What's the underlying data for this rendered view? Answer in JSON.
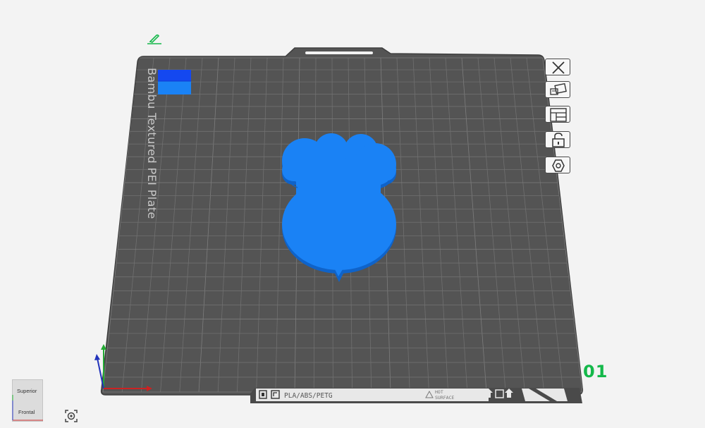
{
  "plate": {
    "name_text": "Bambu Textured PEI Plate",
    "filaments_text": "PLA/ABS/PETG",
    "surface_text_line1": "HOT",
    "surface_text_line2": "SURFACE",
    "number": "01"
  },
  "view_cube": {
    "top_label": "Superior",
    "front_label": "Frontal"
  },
  "sidebar_tools": [
    {
      "id": "delete-plate",
      "icon": "close-icon"
    },
    {
      "id": "arrange",
      "icon": "arrange-icon"
    },
    {
      "id": "orient",
      "icon": "orient-icon"
    },
    {
      "id": "lock",
      "icon": "lock-icon"
    },
    {
      "id": "plate-settings",
      "icon": "hexagon-icon"
    }
  ],
  "colors": {
    "plate": "#545454",
    "grid": "#6f6f6f",
    "model": "#1a82f5",
    "model_side": "#0f63c9",
    "accent_green": "#14b84a",
    "wipe_tower": "#1448f0"
  }
}
